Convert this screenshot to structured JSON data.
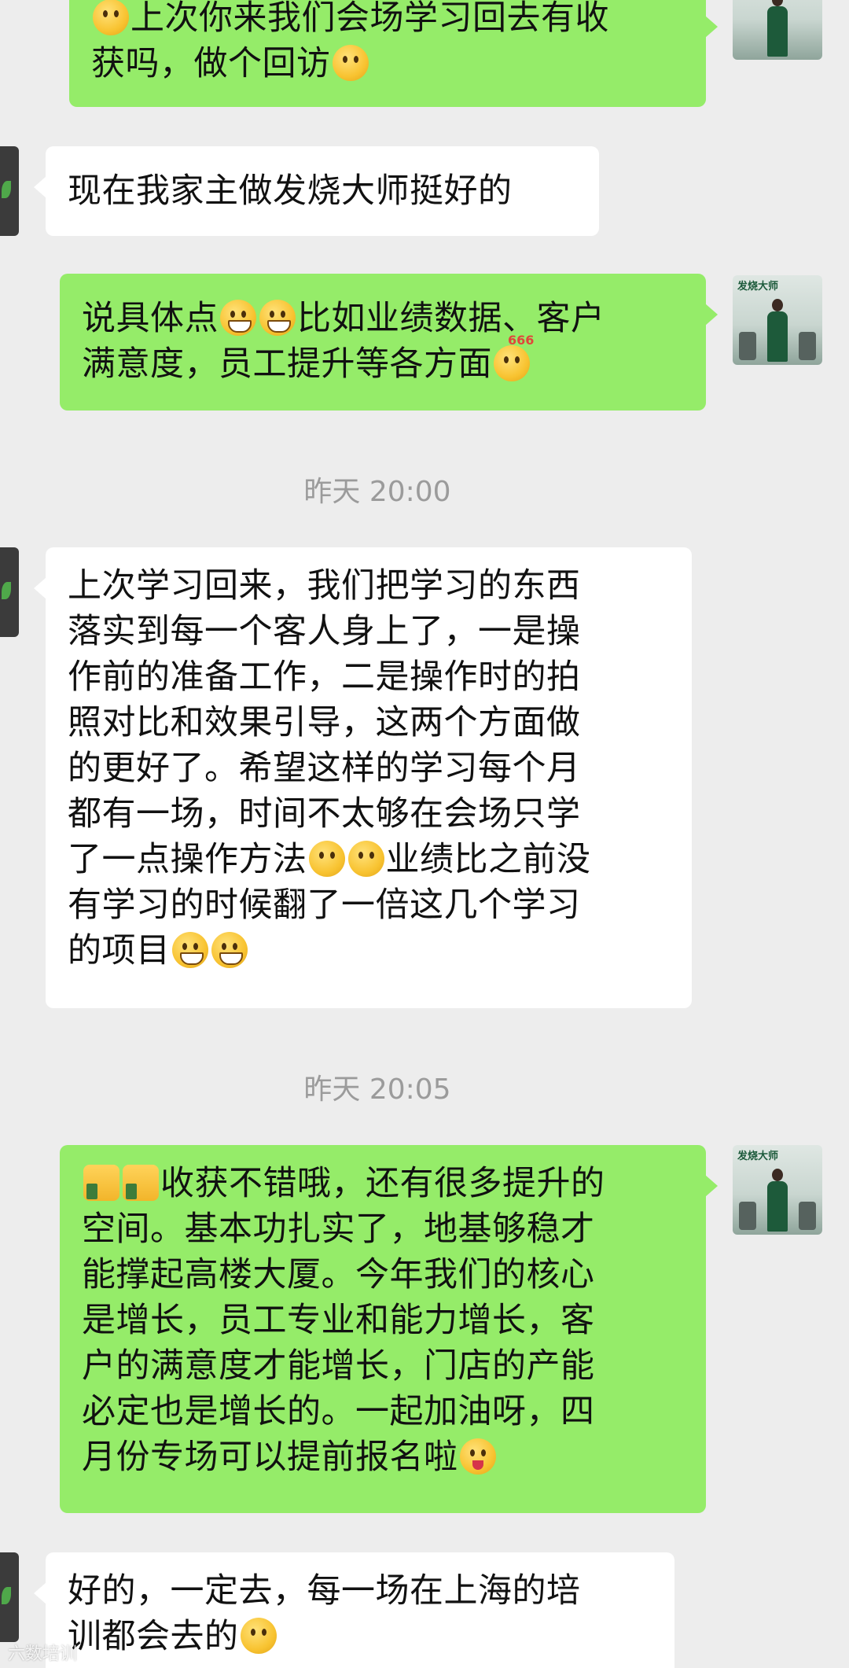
{
  "messages": [
    {
      "direction": "out",
      "lines": [
        "上次你来我们会场学习回去有收",
        "获吗，做个回访"
      ]
    },
    {
      "direction": "in",
      "lines": [
        "现在我家主做发烧大师挺好的"
      ]
    },
    {
      "direction": "out",
      "lines": [
        "说具体点",
        "比如业绩数据、客户",
        "满意度，员工提升等各方面"
      ]
    },
    {
      "direction": "in",
      "lines": [
        "上次学习回来，我们把学习的东西",
        "落实到每一个客人身上了，一是操",
        "作前的准备工作，二是操作时的拍",
        "照对比和效果引导，这两个方面做",
        "的更好了。希望这样的学习每个月",
        "都有一场，时间不太够在会场只学",
        "了一点操作方法",
        "业绩比之前没",
        "有学习的时候翻了一倍这几个学习",
        "的项目"
      ]
    },
    {
      "direction": "out",
      "lines": [
        "收获不错哦，还有很多提升的",
        "空间。基本功扎实了，地基够稳才",
        "能撑起高楼大厦。今年我们的核心",
        "是增长，员工专业和能力增长，客",
        "户的满意度才能增长，门店的产能",
        "必定也是增长的。一起加油呀，四",
        "月份专场可以提前报名啦"
      ]
    },
    {
      "direction": "in",
      "lines": [
        "好的，一定去，每一场在上海的培",
        "训都会去的"
      ]
    }
  ],
  "timestamps": [
    "昨天 20:00",
    "昨天 20:05"
  ],
  "emoji_badge": "666",
  "avatar_banner": "发烧大师",
  "watermark": "六数培训",
  "colors": {
    "background": "#ededed",
    "outgoing_bubble": "#95ec69",
    "incoming_bubble": "#ffffff",
    "timestamp_text": "#9b9b9b"
  },
  "icons": [
    "avatar",
    "emoji-grin",
    "emoji-thumbs-up",
    "emoji-wink",
    "emoji-smile",
    "emoji-hmm"
  ]
}
